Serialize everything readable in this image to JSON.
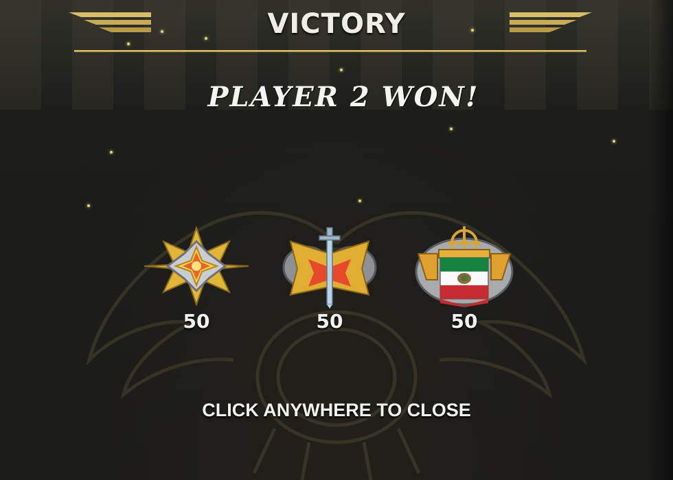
{
  "header": {
    "title": "VICTORY"
  },
  "result": {
    "message": "PLAYER 2 WON!"
  },
  "medals": [
    {
      "icon": "star-medal-icon",
      "value": "50"
    },
    {
      "icon": "sword-medal-icon",
      "value": "50"
    },
    {
      "icon": "mexico-flag-medal-icon",
      "value": "50"
    }
  ],
  "footer": {
    "hint": "CLICK ANYWHERE TO CLOSE"
  },
  "colors": {
    "gold": "#e6cf80",
    "text": "#f0eee4",
    "background": "#1c1c1b"
  }
}
